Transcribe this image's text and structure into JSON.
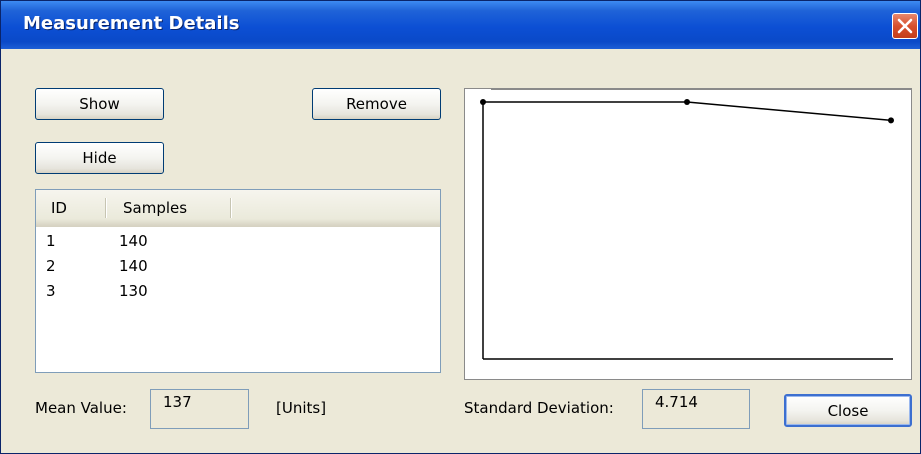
{
  "window": {
    "title": "Measurement Details",
    "close_icon": "close-icon"
  },
  "buttons": {
    "show": "Show",
    "hide": "Hide",
    "remove": "Remove",
    "close": "Close"
  },
  "table": {
    "columns": [
      "ID",
      "Samples"
    ],
    "rows": [
      {
        "id": "1",
        "samples": "140"
      },
      {
        "id": "2",
        "samples": "140"
      },
      {
        "id": "3",
        "samples": "130"
      }
    ]
  },
  "footer": {
    "mean_label": "Mean Value:",
    "mean_value": "137",
    "units_label": "[Units]",
    "stddev_label": "Standard Deviation:",
    "stddev_value": "4.714"
  },
  "chart_data": {
    "type": "line",
    "x": [
      1,
      2,
      3
    ],
    "series": [
      {
        "values": [
          140,
          140,
          130
        ]
      }
    ],
    "ylim": [
      0,
      140
    ],
    "grid": false
  },
  "colors": {
    "titlebar": "#0a49c8",
    "dialog_bg": "#ece9d8",
    "close_button": "#d7502d"
  }
}
